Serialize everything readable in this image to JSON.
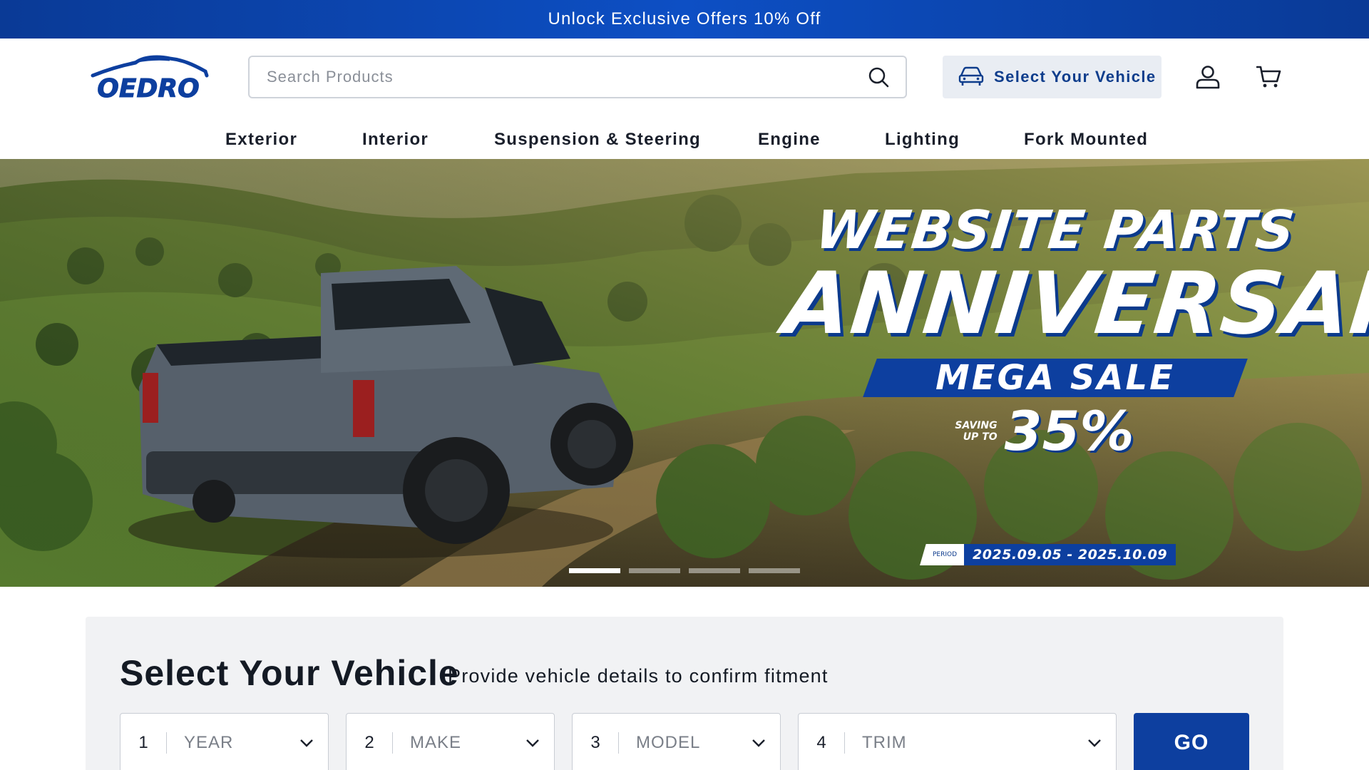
{
  "promo": {
    "text": "Unlock Exclusive Offers 10% Off"
  },
  "header": {
    "logo_text": "OEDRO",
    "search_placeholder": "Search Products",
    "vehicle_button_label": "Select Your Vehicle",
    "icons": [
      "search-icon",
      "car-icon",
      "account-icon",
      "cart-icon"
    ]
  },
  "nav": {
    "items": [
      {
        "label": "Exterior"
      },
      {
        "label": "Interior"
      },
      {
        "label": "Suspension & Steering"
      },
      {
        "label": "Engine"
      },
      {
        "label": "Lighting"
      },
      {
        "label": "Fork Mounted"
      }
    ]
  },
  "hero": {
    "line1": "WEBSITE PARTS",
    "line2": "ANNIVERSARY",
    "mega": "MEGA SALE",
    "saving_small_1": "SAVING",
    "saving_small_2": "UP TO",
    "saving_big": "35%",
    "period_label": "PERIOD",
    "period_dates": "2025.09.05 - 2025.10.09",
    "slides_total": 4,
    "active_slide": 1
  },
  "selector": {
    "title": "Select Your Vehicle",
    "subtitle": "Provide vehicle details to confirm fitment",
    "fields": [
      {
        "num": "1",
        "label": "YEAR"
      },
      {
        "num": "2",
        "label": "MAKE"
      },
      {
        "num": "3",
        "label": "MODEL"
      },
      {
        "num": "4",
        "label": "TRIM"
      }
    ],
    "go_label": "GO"
  },
  "colors": {
    "brand_blue": "#0d3f9f",
    "promo_blue": "#0d4fc4",
    "vehicle_btn_bg": "#e9edf3",
    "selector_bg": "#f1f2f4"
  }
}
